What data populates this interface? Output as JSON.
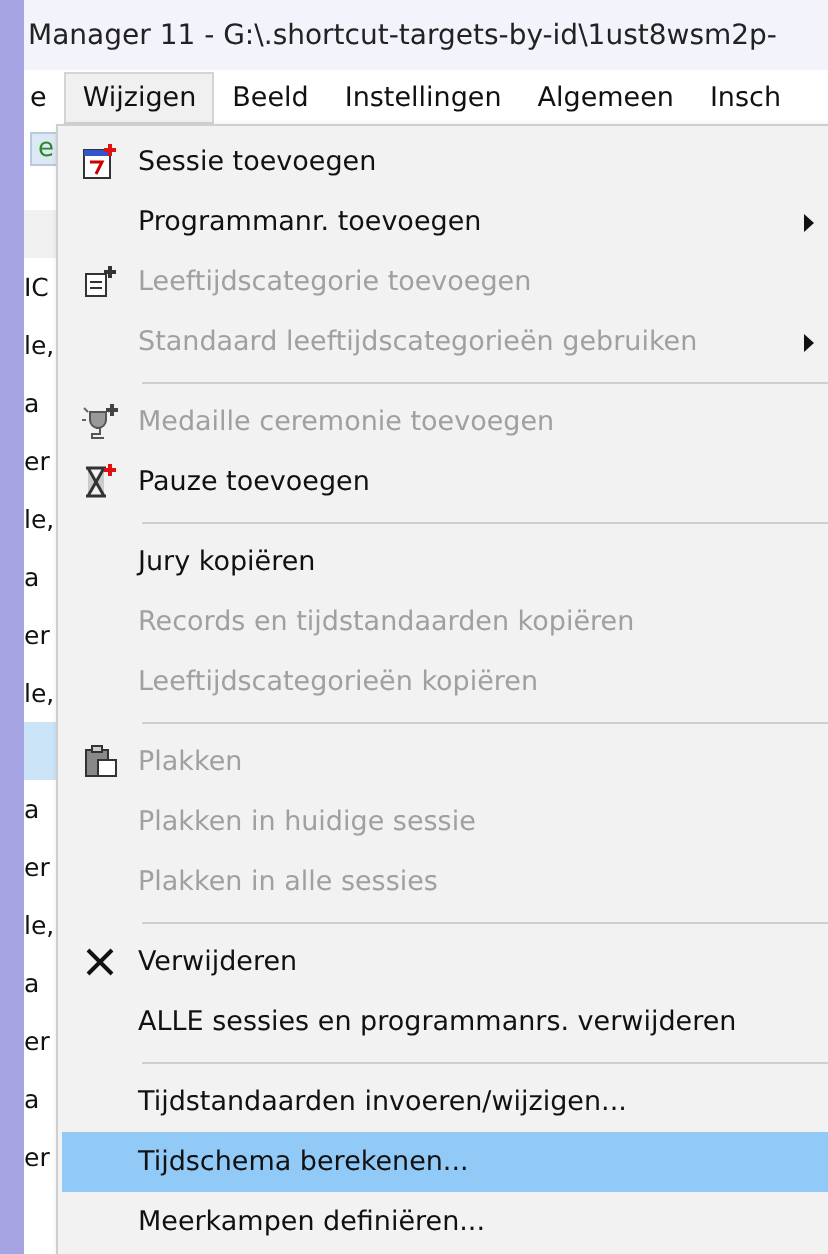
{
  "window": {
    "title": "Manager 11 - G:\\.shortcut-targets-by-id\\1ust8wsm2p-"
  },
  "menubar": [
    {
      "label": "e",
      "selected": false
    },
    {
      "label": "Wijzigen",
      "selected": true
    },
    {
      "label": "Beeld",
      "selected": false
    },
    {
      "label": "Instellingen",
      "selected": false
    },
    {
      "label": "Algemeen",
      "selected": false
    },
    {
      "label": "Insch",
      "selected": false
    }
  ],
  "toolbar": {
    "button_label": "e"
  },
  "background_rows": [
    {
      "text": "IC",
      "selected": false
    },
    {
      "text": "le,",
      "selected": false
    },
    {
      "text": "a",
      "selected": false
    },
    {
      "text": "er",
      "selected": false
    },
    {
      "text": "le,",
      "selected": false
    },
    {
      "text": "a",
      "selected": false
    },
    {
      "text": "er",
      "selected": false
    },
    {
      "text": "le,",
      "selected": false
    },
    {
      "text": "",
      "selected": true
    },
    {
      "text": "a",
      "selected": false
    },
    {
      "text": "er",
      "selected": false
    },
    {
      "text": "le,",
      "selected": false
    },
    {
      "text": "a",
      "selected": false
    },
    {
      "text": "er",
      "selected": false
    },
    {
      "text": "a",
      "selected": false
    },
    {
      "text": "er",
      "selected": false
    }
  ],
  "menu": [
    {
      "kind": "item",
      "label": "Sessie toevoegen",
      "disabled": false,
      "submenu": false,
      "selected": false
    },
    {
      "kind": "item",
      "label": "Programmanr. toevoegen",
      "disabled": false,
      "submenu": true,
      "selected": false
    },
    {
      "kind": "item",
      "label": "Leeftijdscategorie toevoegen",
      "disabled": true,
      "submenu": false,
      "selected": false
    },
    {
      "kind": "item",
      "label": "Standaard leeftijdscategorieën gebruiken",
      "disabled": true,
      "submenu": true,
      "selected": false
    },
    {
      "kind": "separator"
    },
    {
      "kind": "item",
      "label": "Medaille ceremonie toevoegen",
      "disabled": true,
      "submenu": false,
      "selected": false
    },
    {
      "kind": "item",
      "label": "Pauze toevoegen",
      "disabled": false,
      "submenu": false,
      "selected": false
    },
    {
      "kind": "separator"
    },
    {
      "kind": "item",
      "label": "Jury kopiëren",
      "disabled": false,
      "submenu": false,
      "selected": false
    },
    {
      "kind": "item",
      "label": "Records en tijdstandaarden kopiëren",
      "disabled": true,
      "submenu": false,
      "selected": false
    },
    {
      "kind": "item",
      "label": "Leeftijdscategorieën kopiëren",
      "disabled": true,
      "submenu": false,
      "selected": false
    },
    {
      "kind": "separator"
    },
    {
      "kind": "item",
      "label": "Plakken",
      "disabled": true,
      "submenu": false,
      "selected": false
    },
    {
      "kind": "item",
      "label": "Plakken in huidige sessie",
      "disabled": true,
      "submenu": false,
      "selected": false
    },
    {
      "kind": "item",
      "label": "Plakken in alle sessies",
      "disabled": true,
      "submenu": false,
      "selected": false
    },
    {
      "kind": "separator"
    },
    {
      "kind": "item",
      "label": "Verwijderen",
      "disabled": false,
      "submenu": false,
      "selected": false
    },
    {
      "kind": "item",
      "label": "ALLE sessies en programmanrs. verwijderen",
      "disabled": false,
      "submenu": false,
      "selected": false
    },
    {
      "kind": "separator"
    },
    {
      "kind": "item",
      "label": "Tijdstandaarden invoeren/wijzigen...",
      "disabled": false,
      "submenu": false,
      "selected": false
    },
    {
      "kind": "item",
      "label": "Tijdschema berekenen...",
      "disabled": false,
      "submenu": false,
      "selected": true
    },
    {
      "kind": "item",
      "label": "Meerkampen definiëren...",
      "disabled": false,
      "submenu": false,
      "selected": false
    }
  ]
}
